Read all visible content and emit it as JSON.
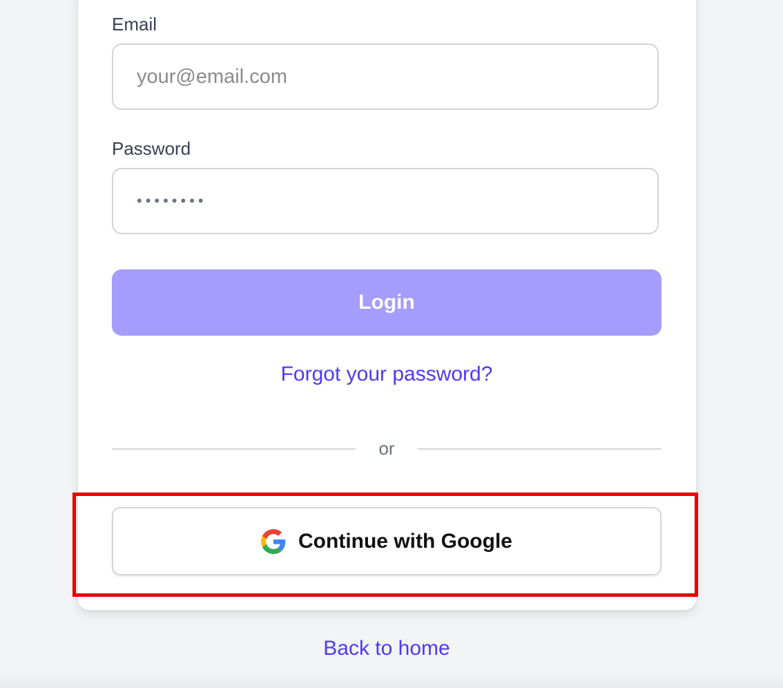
{
  "form": {
    "email_label": "Email",
    "email_placeholder": "your@email.com",
    "email_value": "",
    "password_label": "Password",
    "password_value": "••••••••",
    "login_label": "Login",
    "forgot_label": "Forgot your password?",
    "divider_text": "or",
    "google_label": "Continue with Google"
  },
  "footer": {
    "back_label": "Back to home"
  },
  "colors": {
    "primary": "#4f39f6",
    "login_button_disabled": "#a59cfb",
    "highlight": "#e60000",
    "background": "#f3f4f6"
  },
  "icons": {
    "google": "google-logo-icon"
  }
}
